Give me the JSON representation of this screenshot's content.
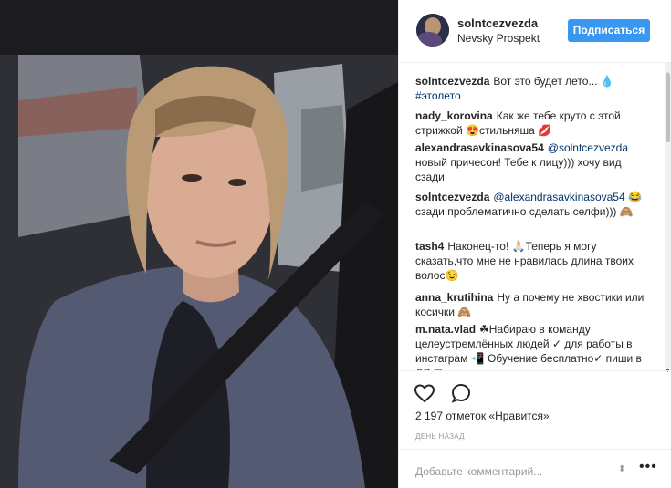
{
  "post": {
    "username": "solntcezvezda",
    "location": "Nevsky Prospekt",
    "follow_label": "Подписаться"
  },
  "comments": [
    {
      "user": "solntcezvezda",
      "text": "Вот это будет лето... 💧",
      "hashtag": "#этолето"
    },
    {
      "user": "nady_korovina",
      "text": "Как же тебе круто с этой стрижкой 😍стильняша 💋"
    },
    {
      "user": "alexandrasavkinasova54",
      "mention": "@solntcezvezda",
      "text": "новый причесон! Тебе к лицу))) хочу вид сзади"
    },
    {
      "user": "solntcezvezda",
      "mention": "@alexandrasavkinasova54",
      "text": "😂 сзади проблематично сделать селфи))) 🙈"
    },
    {
      "user": "tash4",
      "text": "Наконец-то! 🙏🏻Теперь я могу сказать,что мне не нравилась длина твоих волос😉"
    },
    {
      "user": "anna_krutihina",
      "text": "Ну а почему не хвостики или косички 🙈"
    },
    {
      "user": "m.nata.vlad",
      "text": "☘Набираю в команду целеустремлённых людей ✓ для работы в инстаграм 📲 Обучение бесплатно✓ пиши в ЛС ✉"
    }
  ],
  "likes_text": "2 197 отметок «Нравится»",
  "time_text": "ДЕНЬ НАЗАД",
  "add_comment_placeholder": "Добавьте комментарий...",
  "icons": {
    "like": "heart-icon",
    "comment": "speech-bubble-icon",
    "more": "more-dots-icon"
  },
  "colors": {
    "accent": "#3897f0",
    "mention": "#003569"
  }
}
